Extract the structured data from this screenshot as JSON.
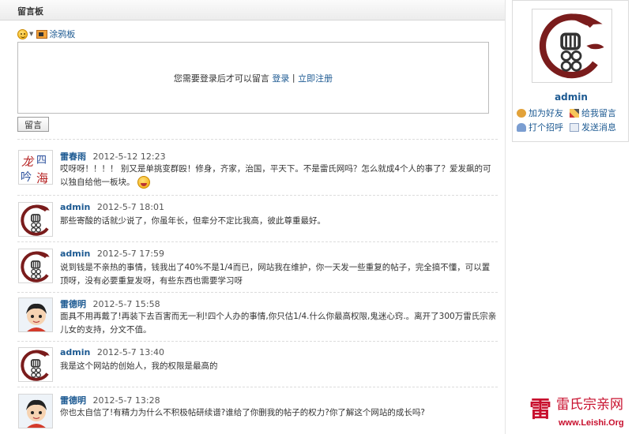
{
  "board": {
    "title": "留言板",
    "doodle_label": "涂鸦板",
    "login_prompt": "您需要登录后才可以留言",
    "login_link": "登录",
    "separator": "|",
    "register_link": "立即注册",
    "submit_label": "留言"
  },
  "comments": [
    {
      "author": "雷春雨",
      "time": "2012-5-12 12:23",
      "text": "哎呀呀！！！！  别又是单挑变群殴！修身，齐家，治国，平天下。不是雷氏网吗？怎么就成4个人的事了？爱发飙的可以独自给他一板块。",
      "avatar": "calligraphy-avatar",
      "avatar_text": "龙四吟海"
    },
    {
      "author": "admin",
      "time": "2012-5-7 18:01",
      "text": "那些寄酸的话就少说了，你虽年长，但辈分不定比我高，彼此尊重最好。",
      "avatar": "leishi-logo-avatar"
    },
    {
      "author": "admin",
      "time": "2012-5-7 17:59",
      "text": "说到钱是不亲热的事情，钱我出了40%不是1/4而已，网站我在维护，你一天发一些重复的帖子，完全搞不懂，可以置顶呀，没有必要重复发呀，有些东西也需要学习呀",
      "avatar": "leishi-logo-avatar"
    },
    {
      "author": "雷德明",
      "time": "2012-5-7 15:58",
      "text": "面具不用再戴了!再装下去百害而无一利!四个人办的事情,你只估1/4.什么你最高权限,鬼迷心窍.。离开了300万雷氏宗亲儿女的支持，分文不值。",
      "avatar": "cartoon-boy-avatar"
    },
    {
      "author": "admin",
      "time": "2012-5-7 13:40",
      "text": "我是这个网站的创始人，我的权限是最高的",
      "avatar": "leishi-logo-avatar"
    },
    {
      "author": "雷德明",
      "time": "2012-5-7 13:28",
      "text": "你也太自信了!有精力为什么不积极帖研续谱?谁给了你删我的帖子的权力?你了解这个网站的成长吗?",
      "avatar": "cartoon-boy-avatar"
    }
  ],
  "profile": {
    "name": "admin",
    "add_friend": "加为好友",
    "leave_message": "给我留言",
    "greet": "打个招呼",
    "send_message": "发送消息"
  },
  "watermark": {
    "text": "雷氏宗亲网",
    "url": "www.Leishi.Org"
  },
  "colors": {
    "link": "#1d5a92",
    "logo_red": "#7a1c1c",
    "watermark_red": "#c8102e"
  }
}
